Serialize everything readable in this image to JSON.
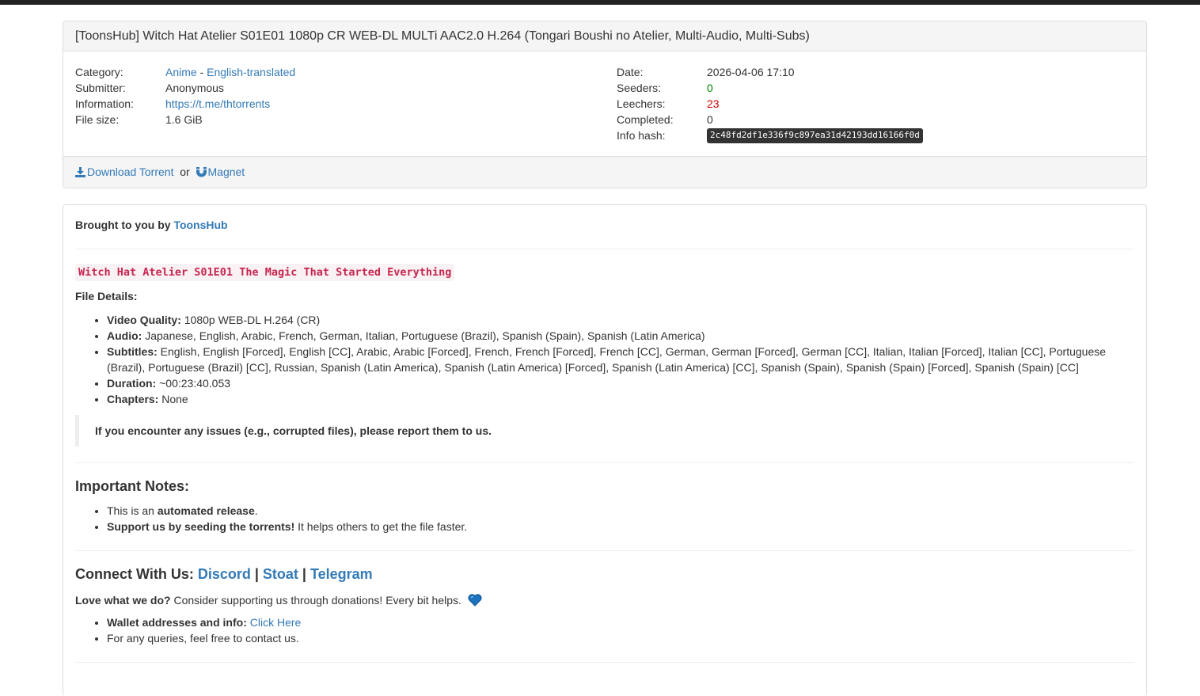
{
  "torrent": {
    "title": "[ToonsHub] Witch Hat Atelier S01E01 1080p CR WEB-DL MULTi AAC2.0 H.264 (Tongari Boushi no Atelier, Multi-Audio, Multi-Subs)",
    "labels": {
      "category": "Category:",
      "submitter": "Submitter:",
      "information": "Information:",
      "file_size": "File size:",
      "date": "Date:",
      "seeders": "Seeders:",
      "leechers": "Leechers:",
      "completed": "Completed:",
      "info_hash": "Info hash:"
    },
    "category_main": "Anime",
    "category_sep": " - ",
    "category_sub": "English-translated",
    "submitter": "Anonymous",
    "information": "https://t.me/thtorrents",
    "file_size": "1.6 GiB",
    "date": "2026-04-06 17:10",
    "seeders": "0",
    "leechers": "23",
    "completed": "0",
    "info_hash": "2c48fd2df1e336f9c897ea31d42193dd16166f0d",
    "download_label": "Download Torrent",
    "or_text": " or ",
    "magnet_label": "Magnet"
  },
  "description": {
    "brought_by": "Brought to you by",
    "brought_by_link": "ToonsHub",
    "episode_title": "Witch Hat Atelier S01E01 The Magic That Started Everything",
    "file_details": "File Details:",
    "details": [
      {
        "key": "Video Quality:",
        "value": " 1080p WEB-DL H.264 (CR)"
      },
      {
        "key": "Audio:",
        "value": " Japanese, English, Arabic, French, German, Italian, Portuguese (Brazil), Spanish (Spain), Spanish (Latin America)"
      },
      {
        "key": "Subtitles:",
        "value": " English, English [Forced], English [CC], Arabic, Arabic [Forced], French, French [Forced], French [CC], German, German [Forced], German [CC], Italian, Italian [Forced], Italian [CC], Portuguese (Brazil), Portuguese (Brazil) [CC], Russian, Spanish (Latin America), Spanish (Latin America) [Forced], Spanish (Latin America) [CC], Spanish (Spain), Spanish (Spain) [Forced], Spanish (Spain) [CC]"
      },
      {
        "key": "Duration:",
        "value": " ~00:23:40.053"
      },
      {
        "key": "Chapters:",
        "value": " None"
      }
    ],
    "issues_note": "If you encounter any issues (e.g., corrupted files), please report them to us.",
    "important_heading": "Important Notes:",
    "note1_pre": "This is an ",
    "note1_bold": "automated release",
    "note1_post": ".",
    "note2_bold": "Support us by seeding the torrents!",
    "note2_post": " It helps others to get the file faster.",
    "connect_heading": "Connect With Us: ",
    "connect_links": [
      "Discord",
      "Stoat",
      "Telegram"
    ],
    "connect_sep": " | ",
    "love_bold": "Love what we do?",
    "love_text": " Consider supporting us through donations! Every bit helps.",
    "wallet_bold": "Wallet addresses and info:",
    "wallet_link": "Click Here",
    "queries": "For any queries, feel free to contact us."
  },
  "colors": {
    "link": "#337ab7",
    "seeders": "#008000",
    "leechers": "#cc0000",
    "code_text": "#c7254e",
    "heart": "#1e73be"
  }
}
